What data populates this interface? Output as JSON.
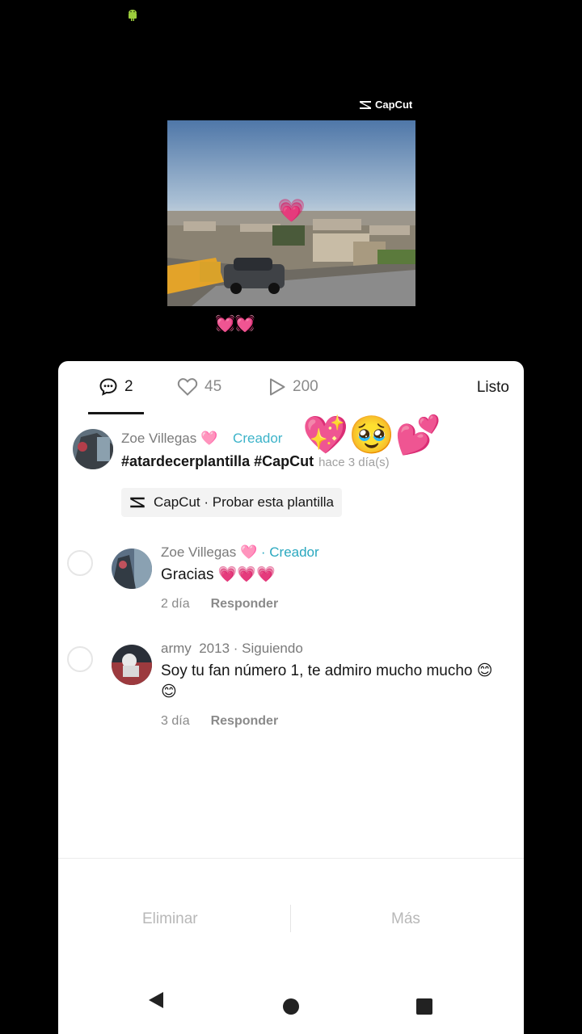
{
  "watermark": "CapCut",
  "caption_hearts": "💓💓",
  "preview_heart": "💗",
  "stats": {
    "comments": "2",
    "likes": "45",
    "plays": "200",
    "done": "Listo"
  },
  "caption": {
    "author": "Zoe Villegas 🩷",
    "creator": "Creador",
    "text": "#atardecerplantilla #CapCut",
    "time": "hace 3 día(s)",
    "emojis": "💖🥹💕",
    "template_button": "CapCut · Probar esta plantilla"
  },
  "comments": [
    {
      "author": "Zoe Villegas 🩷",
      "badge": "· Creador",
      "text": "Gracias 💗💗💗",
      "time": "2 día",
      "reply": "Responder"
    },
    {
      "author": "army  2013",
      "badge": "· Siguiendo",
      "text": "Soy tu fan número 1, te admiro mucho mucho 😊😊",
      "time": "3 día",
      "reply": "Responder"
    }
  ],
  "actions": {
    "delete": "Eliminar",
    "more": "Más"
  },
  "colors": {
    "creator": "#2aa8bf",
    "muted": "#8a8a8a",
    "text": "#161616"
  }
}
